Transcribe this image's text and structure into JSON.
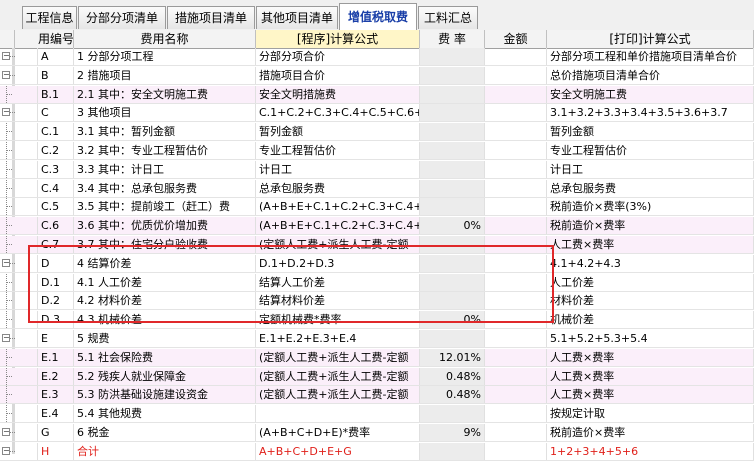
{
  "tabs": [
    {
      "label": "工程信息",
      "active": false
    },
    {
      "label": "分部分项清单",
      "active": false
    },
    {
      "label": "措施项目清单",
      "active": false
    },
    {
      "label": "其他项目清单",
      "active": false
    },
    {
      "label": "增值税取费",
      "active": true
    },
    {
      "label": "工料汇总",
      "active": false
    }
  ],
  "columns": {
    "code": "用编号",
    "name": "费用名称",
    "formula": "[程序]计算公式",
    "rate": "费 率",
    "amount": "金额",
    "print": "[打印]计算公式"
  },
  "rows": [
    {
      "tree": "minus",
      "code": "A",
      "name": "1 分部分项工程",
      "formula": "分部分项合价",
      "rate": "",
      "amount": "",
      "print": "分部分项工程和单价措施项目清单合价"
    },
    {
      "tree": "minus",
      "code": "B",
      "name": "2 措施项目",
      "formula": "措施项目合价",
      "rate": "",
      "amount": "",
      "print": "总价措施项目清单合价"
    },
    {
      "tree": "line",
      "code": "B.1",
      "name": "2.1 其中：安全文明施工费",
      "formula": "安全文明措施费",
      "rate": "",
      "amount": "",
      "print": "安全文明施工费",
      "pink": true
    },
    {
      "tree": "minus",
      "code": "C",
      "name": "3 其他项目",
      "formula": "C.1+C.2+C.3+C.4+C.5+C.6+C.7",
      "rate": "",
      "amount": "",
      "print": "3.1+3.2+3.3+3.4+3.5+3.6+3.7"
    },
    {
      "tree": "line",
      "code": "C.1",
      "name": "3.1 其中：暂列金额",
      "formula": "暂列金额",
      "rate": "",
      "amount": "",
      "print": "暂列金额"
    },
    {
      "tree": "line",
      "code": "C.2",
      "name": "3.2 其中：专业工程暂估价",
      "formula": "专业工程暂估价",
      "rate": "",
      "amount": "",
      "print": "专业工程暂估价"
    },
    {
      "tree": "line",
      "code": "C.3",
      "name": "3.3 其中：计日工",
      "formula": "计日工",
      "rate": "",
      "amount": "",
      "print": "计日工"
    },
    {
      "tree": "line",
      "code": "C.4",
      "name": "3.4 其中：总承包服务费",
      "formula": "总承包服务费",
      "rate": "",
      "amount": "",
      "print": "总承包服务费"
    },
    {
      "tree": "line",
      "code": "C.5",
      "name": "3.5 其中：提前竣工（赶工）费",
      "formula": "(A+B+E+C.1+C.2+C.3+C.4+C.7)",
      "rate": "",
      "amount": "",
      "print": "税前造价×费率(3%)"
    },
    {
      "tree": "line",
      "code": "C.6",
      "name": "3.6 其中：优质优价增加费",
      "formula": "(A+B+E+C.1+C.2+C.3+C.4+C.5+",
      "rate": "0%",
      "amount": "",
      "print": "税前造价×费率",
      "pink": true
    },
    {
      "tree": "line",
      "code": "C.7",
      "name": "3.7 其中：住宅分户验收费",
      "formula": "(定额人工费+派生人工费-定额",
      "rate": "",
      "amount": "",
      "print": "人工费×费率",
      "pink": true
    },
    {
      "tree": "minus",
      "code": "D",
      "name": "4 结算价差",
      "formula": "D.1+D.2+D.3",
      "rate": "",
      "amount": "",
      "print": "4.1+4.2+4.3"
    },
    {
      "tree": "line",
      "code": "D.1",
      "name": "4.1 人工价差",
      "formula": "结算人工价差",
      "rate": "",
      "amount": "",
      "print": "人工价差"
    },
    {
      "tree": "line",
      "code": "D.2",
      "name": "4.2 材料价差",
      "formula": "结算材料价差",
      "rate": "",
      "amount": "",
      "print": "材料价差"
    },
    {
      "tree": "line",
      "code": "D.3",
      "name": "4.3 机械价差",
      "formula": "定额机械费*费率",
      "rate": "0%",
      "amount": "",
      "print": "机械价差"
    },
    {
      "tree": "minus",
      "code": "E",
      "name": "5 规费",
      "formula": "E.1+E.2+E.3+E.4",
      "rate": "",
      "amount": "",
      "print": "5.1+5.2+5.3+5.4"
    },
    {
      "tree": "line",
      "code": "E.1",
      "name": "5.1 社会保险费",
      "formula": "(定额人工费+派生人工费-定额",
      "rate": "12.01%",
      "amount": "",
      "print": "人工费×费率",
      "pink": true
    },
    {
      "tree": "line",
      "code": "E.2",
      "name": "5.2 残疾人就业保障金",
      "formula": "(定额人工费+派生人工费-定额",
      "rate": "0.48%",
      "amount": "",
      "print": "人工费×费率",
      "pink": true
    },
    {
      "tree": "line",
      "code": "E.3",
      "name": "5.3 防洪基础设施建设资金",
      "formula": "(定额人工费+派生人工费-定额",
      "rate": "0.48%",
      "amount": "",
      "print": "人工费×费率",
      "pink": true
    },
    {
      "tree": "line",
      "code": "E.4",
      "name": "5.4 其他规费",
      "formula": "",
      "rate": "",
      "amount": "",
      "print": "按规定计取"
    },
    {
      "tree": "minus",
      "code": "G",
      "name": "6 税金",
      "formula": "(A+B+C+D+E)*费率",
      "rate": "9%",
      "amount": "",
      "print": "税前造价×费率"
    },
    {
      "tree": "minus",
      "code": "H",
      "name": "合计",
      "formula": "A+B+C+D+E+G",
      "rate": "",
      "amount": "",
      "print": "1+2+3+4+5+6",
      "total": true
    }
  ],
  "highlight": {
    "color": "#e0282a",
    "label": "selected rows D–D.3"
  }
}
